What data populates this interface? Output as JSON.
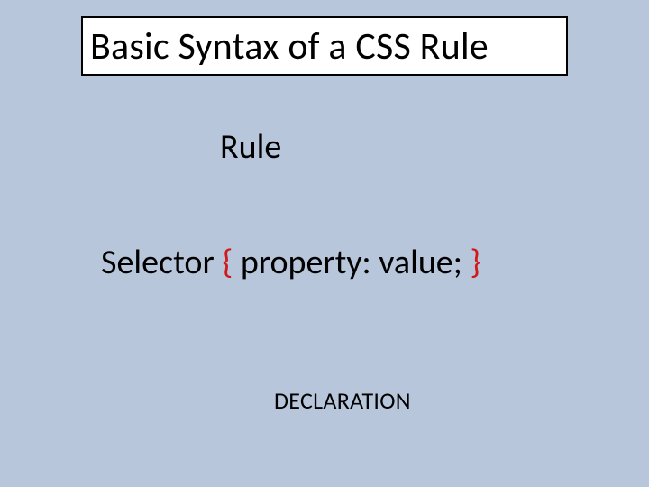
{
  "title": "Basic Syntax of a CSS Rule",
  "labels": {
    "rule": "Rule",
    "declaration": "DECLARATION"
  },
  "syntax": {
    "selector": "Selector ",
    "open": "{ ",
    "body": "property: value; ",
    "close": "}"
  }
}
